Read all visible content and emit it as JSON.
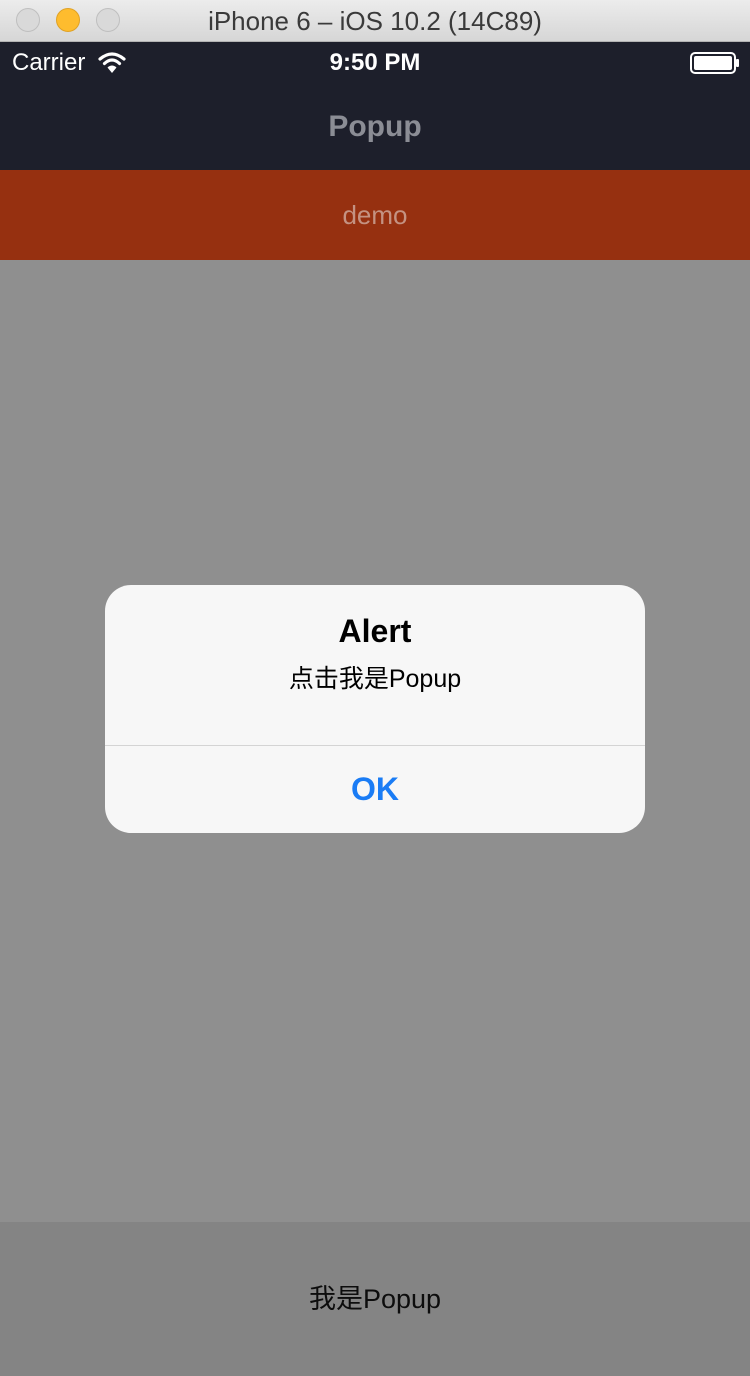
{
  "window": {
    "title": "iPhone 6 – iOS 10.2 (14C89)"
  },
  "status_bar": {
    "carrier": "Carrier",
    "time": "9:50 PM",
    "icons": [
      "wifi-icon",
      "battery-icon"
    ]
  },
  "nav_bar": {
    "title": "Popup"
  },
  "demo_bar": {
    "label": "demo"
  },
  "alert": {
    "title": "Alert",
    "message": "点击我是Popup",
    "button_label": "OK"
  },
  "popup": {
    "label": "我是Popup"
  },
  "colors": {
    "nav_background": "#1d1f2b",
    "demo_background": "#963010",
    "overlay": "#8f8f8f",
    "alert_button": "#1a7cf5"
  }
}
